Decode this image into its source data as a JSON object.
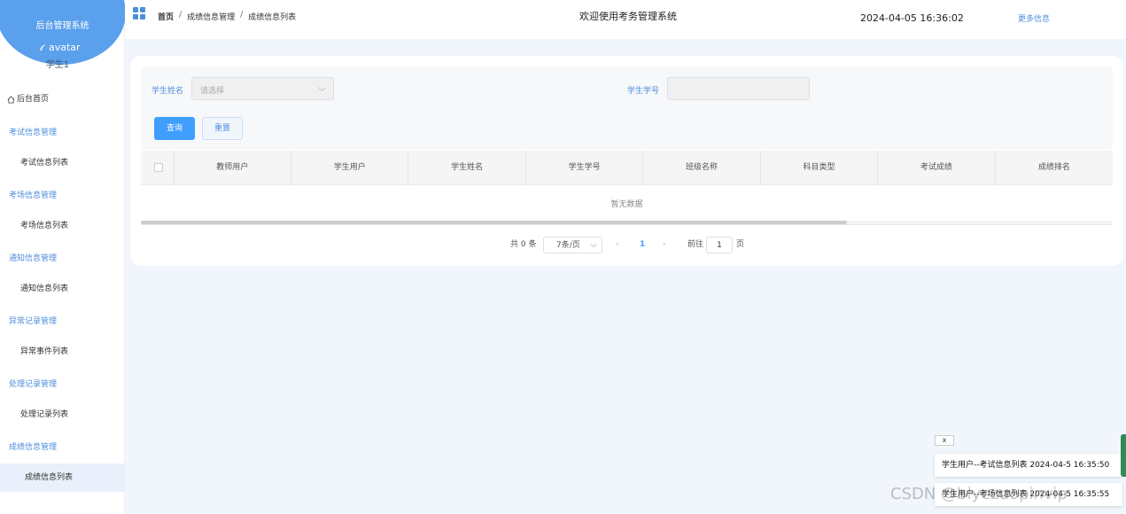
{
  "sidebar": {
    "system_title": "后台管理系统",
    "avatar_alt": "avatar",
    "user_name": "学生1",
    "home": "后台首页",
    "groups": [
      {
        "label": "考试信息管理",
        "sub": "考试信息列表"
      },
      {
        "label": "考场信息管理",
        "sub": "考场信息列表"
      },
      {
        "label": "通知信息管理",
        "sub": "通知信息列表"
      },
      {
        "label": "异常记录管理",
        "sub": "异常事件列表"
      },
      {
        "label": "处理记录管理",
        "sub": "处理记录列表"
      },
      {
        "label": "成绩信息管理",
        "sub": "成绩信息列表"
      }
    ],
    "active_item": "成绩信息列表"
  },
  "topbar": {
    "breadcrumb": [
      "首页",
      "成绩信息管理",
      "成绩信息列表"
    ],
    "separator": "/",
    "welcome": "欢迎使用考务管理系统",
    "datetime": "2024-04-05 16:36:02",
    "more": "更多信息"
  },
  "filters": {
    "name_label": "学生姓名",
    "name_placeholder": "请选择",
    "id_label": "学生学号",
    "id_value": "",
    "query_button": "查询",
    "reset_button": "重置"
  },
  "table": {
    "columns": [
      "教师用户",
      "学生用户",
      "学生姓名",
      "学生学号",
      "班级名称",
      "科目类型",
      "考试成绩",
      "成绩排名"
    ],
    "rows": [],
    "empty_text": "暂无数据"
  },
  "pagination": {
    "total": "共 0 条",
    "page_size": "7条/页",
    "current_page": "1",
    "goto_label": "前往",
    "goto_value": "1",
    "page_unit": "页"
  },
  "notifications": {
    "close": "x",
    "items": [
      "学生用户--考试信息列表 2024-04-5 16:35:50",
      "学生用户--考场信息列表 2024-04-5 16:35:55"
    ]
  },
  "watermark": "CSDN @biyezuopinvip",
  "colors": {
    "accent": "#409eff",
    "sidebar_head": "#5aa0ec",
    "link": "#4d8edb"
  }
}
